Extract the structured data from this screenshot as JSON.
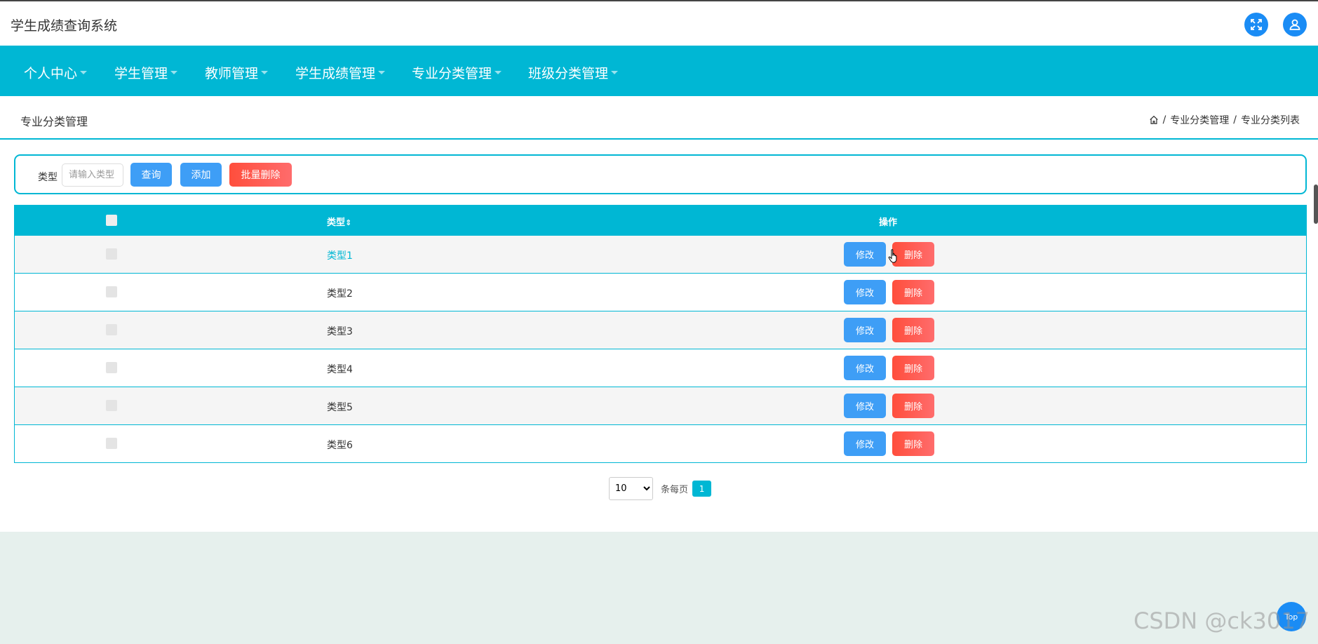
{
  "app": {
    "title": "学生成绩查询系统"
  },
  "topbar": {
    "icons": [
      "fullscreen-icon",
      "user-icon"
    ]
  },
  "nav": {
    "items": [
      {
        "label": "个人中心"
      },
      {
        "label": "学生管理"
      },
      {
        "label": "教师管理"
      },
      {
        "label": "学生成绩管理"
      },
      {
        "label": "专业分类管理"
      },
      {
        "label": "班级分类管理"
      }
    ]
  },
  "page": {
    "title": "专业分类管理",
    "breadcrumb": [
      "专业分类管理",
      "专业分类列表"
    ],
    "breadcrumb_sep": "/"
  },
  "search": {
    "label": "类型",
    "placeholder": "请输入类型",
    "query_label": "查询",
    "add_label": "添加",
    "batch_delete_label": "批量删除"
  },
  "table": {
    "headers": {
      "type": "类型",
      "sort_icon": "⇕",
      "actions": "操作"
    },
    "rows": [
      {
        "type": "类型1",
        "edit": "修改",
        "delete": "删除"
      },
      {
        "type": "类型2",
        "edit": "修改",
        "delete": "删除"
      },
      {
        "type": "类型3",
        "edit": "修改",
        "delete": "删除"
      },
      {
        "type": "类型4",
        "edit": "修改",
        "delete": "删除"
      },
      {
        "type": "类型5",
        "edit": "修改",
        "delete": "删除"
      },
      {
        "type": "类型6",
        "edit": "修改",
        "delete": "删除"
      }
    ]
  },
  "pagination": {
    "page_size": "10",
    "page_size_options": [
      "10"
    ],
    "per_page_label": "条每页",
    "current_page": "1"
  },
  "floating": {
    "top_label": "Top"
  },
  "watermark": "CSDN @ck3017",
  "colors": {
    "accent": "#00b7d4",
    "primary_button": "#3e9ef6",
    "danger_button": "#ff5a48",
    "footer_bg": "#e6f0ed"
  }
}
